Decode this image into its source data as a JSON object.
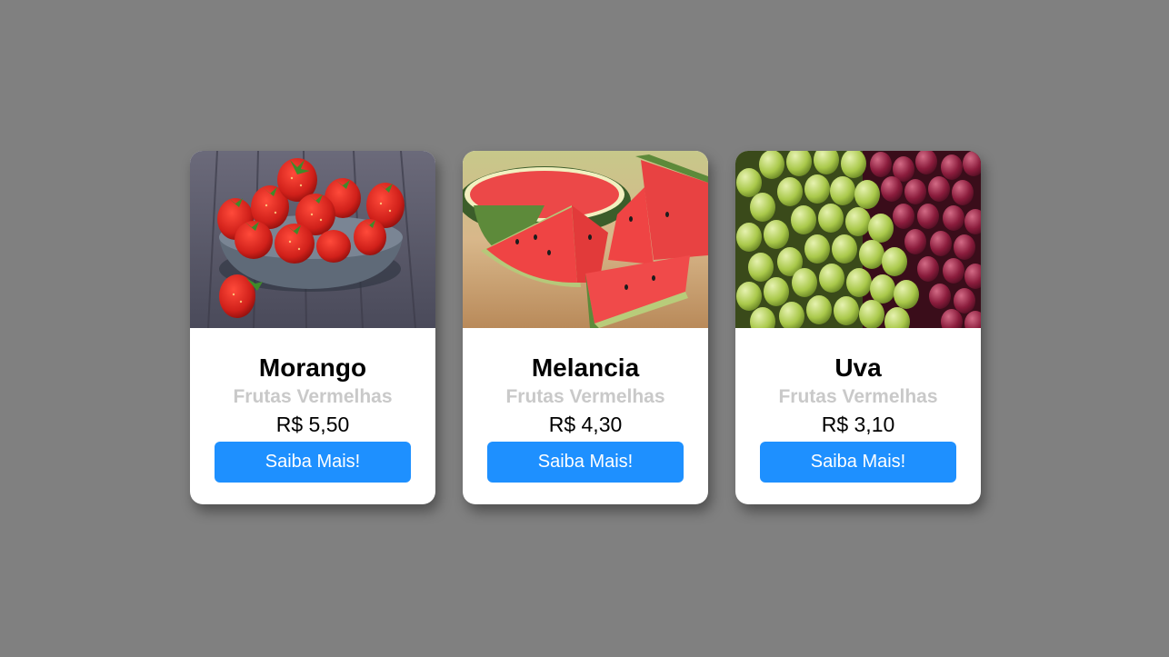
{
  "products": [
    {
      "name": "Morango",
      "category": "Frutas Vermelhas",
      "price": "R$ 5,50",
      "button_label": "Saiba Mais!",
      "image_icon": "strawberry-bowl-photo"
    },
    {
      "name": "Melancia",
      "category": "Frutas Vermelhas",
      "price": "R$ 4,30",
      "button_label": "Saiba Mais!",
      "image_icon": "watermelon-slices-photo"
    },
    {
      "name": "Uva",
      "category": "Frutas Vermelhas",
      "price": "R$ 3,10",
      "button_label": "Saiba Mais!",
      "image_icon": "grapes-photo"
    }
  ],
  "colors": {
    "background": "#808080",
    "card": "#ffffff",
    "button": "#1e90ff",
    "category_text": "#c9c9c9"
  }
}
